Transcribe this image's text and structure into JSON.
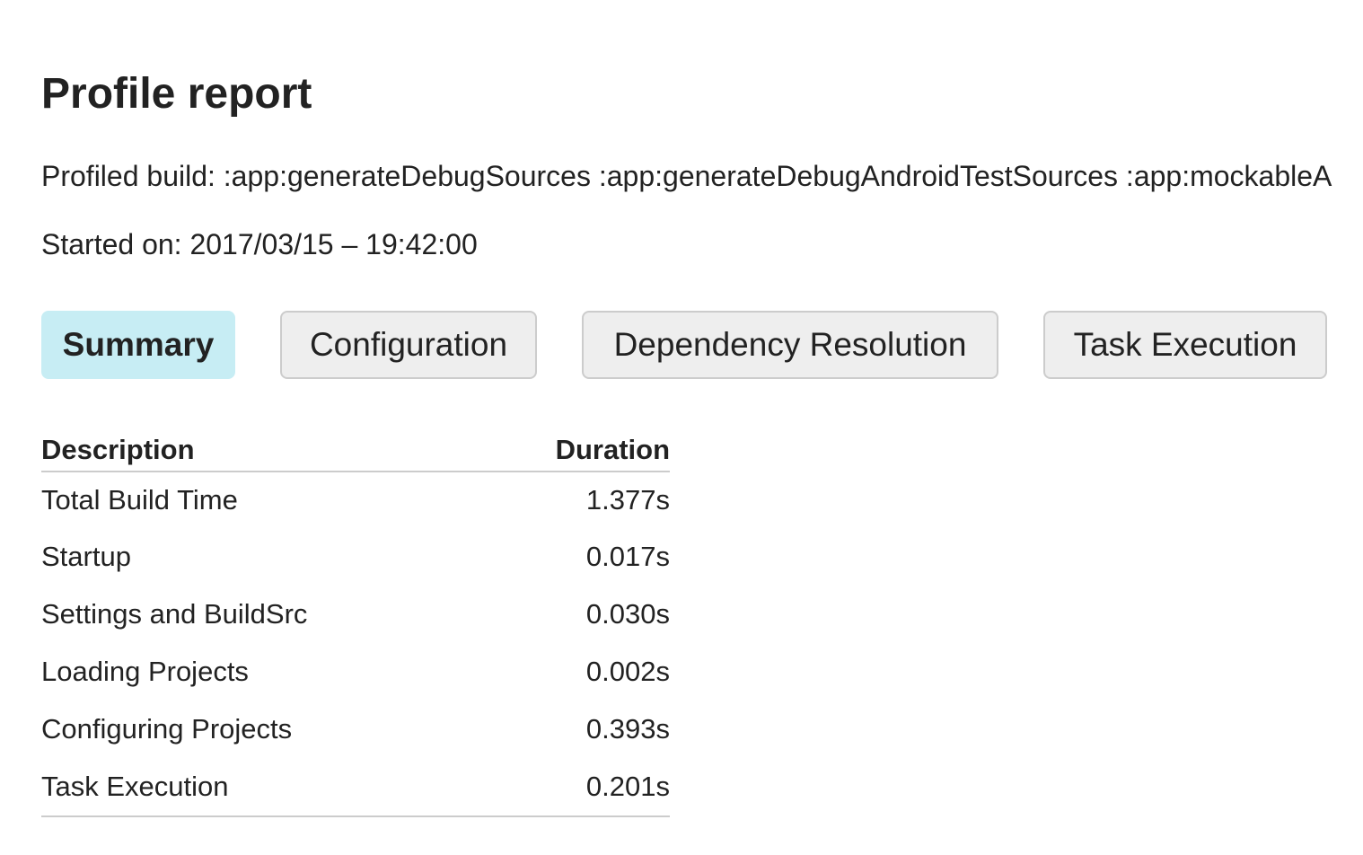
{
  "header": {
    "title": "Profile report",
    "profiled_build": "Profiled build: :app:generateDebugSources :app:generateDebugAndroidTestSources :app:mockableA",
    "started_on": "Started on: 2017/03/15 – 19:42:00"
  },
  "tabs": [
    {
      "label": "Summary",
      "selected": true
    },
    {
      "label": "Configuration",
      "selected": false
    },
    {
      "label": "Dependency Resolution",
      "selected": false
    },
    {
      "label": "Task Execution",
      "selected": false
    }
  ],
  "colors": {
    "selected_tab": "#c7edf4",
    "tab_background": "#eeeeee",
    "border": "#cccccc",
    "text": "#222222"
  },
  "summary_table": {
    "headers": {
      "description": "Description",
      "duration": "Duration"
    },
    "rows": [
      {
        "description": "Total Build Time",
        "duration": "1.377s"
      },
      {
        "description": "Startup",
        "duration": "0.017s"
      },
      {
        "description": "Settings and BuildSrc",
        "duration": "0.030s"
      },
      {
        "description": "Loading Projects",
        "duration": "0.002s"
      },
      {
        "description": "Configuring Projects",
        "duration": "0.393s"
      },
      {
        "description": "Task Execution",
        "duration": "0.201s"
      }
    ]
  }
}
